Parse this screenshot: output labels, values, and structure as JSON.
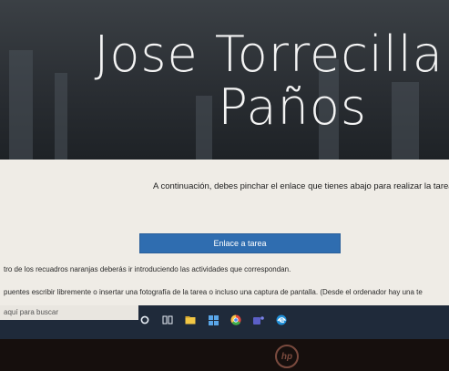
{
  "hero": {
    "title_line1": "Jose Torrecilla",
    "title_line2": "Paños"
  },
  "content": {
    "instruction": "A continuación, debes pinchar el enlace que tienes abajo para realizar la tarea.",
    "cta_label": "Enlace a tarea",
    "line1": "tro de los recuadros naranjas deberás ir introduciendo las actividades que correspondan.",
    "line2": "puentes escribir libremente o insertar una fotografía de la tarea o incluso una captura de pantalla. (Desde el ordenador hay una te"
  },
  "taskbar": {
    "search_placeholder": "aquí para buscar",
    "icons": [
      "start-icon",
      "task-view-icon",
      "file-explorer-icon",
      "store-icon",
      "chrome-icon",
      "teams-icon",
      "edge-icon"
    ]
  },
  "bezel": {
    "brand_icon": "hp-logo"
  }
}
